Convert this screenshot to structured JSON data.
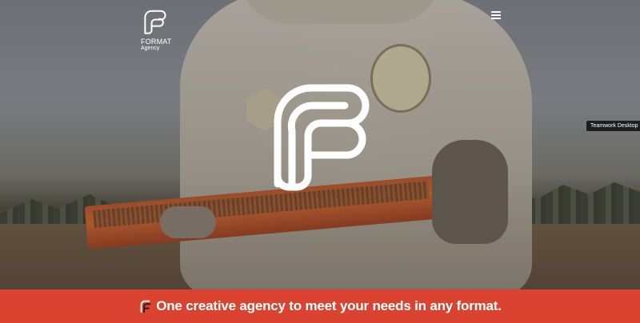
{
  "brand": {
    "name": "FORMAT",
    "sub": "Agency",
    "logo_icon": "format-f-logo-icon"
  },
  "nav": {
    "menu_icon": "hamburger-menu-icon"
  },
  "hero": {
    "logo_icon": "format-f-logo-icon"
  },
  "tooltip": {
    "label": "Teamwork Desktop"
  },
  "bottom_bar": {
    "tagline": "One creative agency to meet your needs in any format.",
    "icon": "format-f-small-icon",
    "background": "#d9432f"
  }
}
